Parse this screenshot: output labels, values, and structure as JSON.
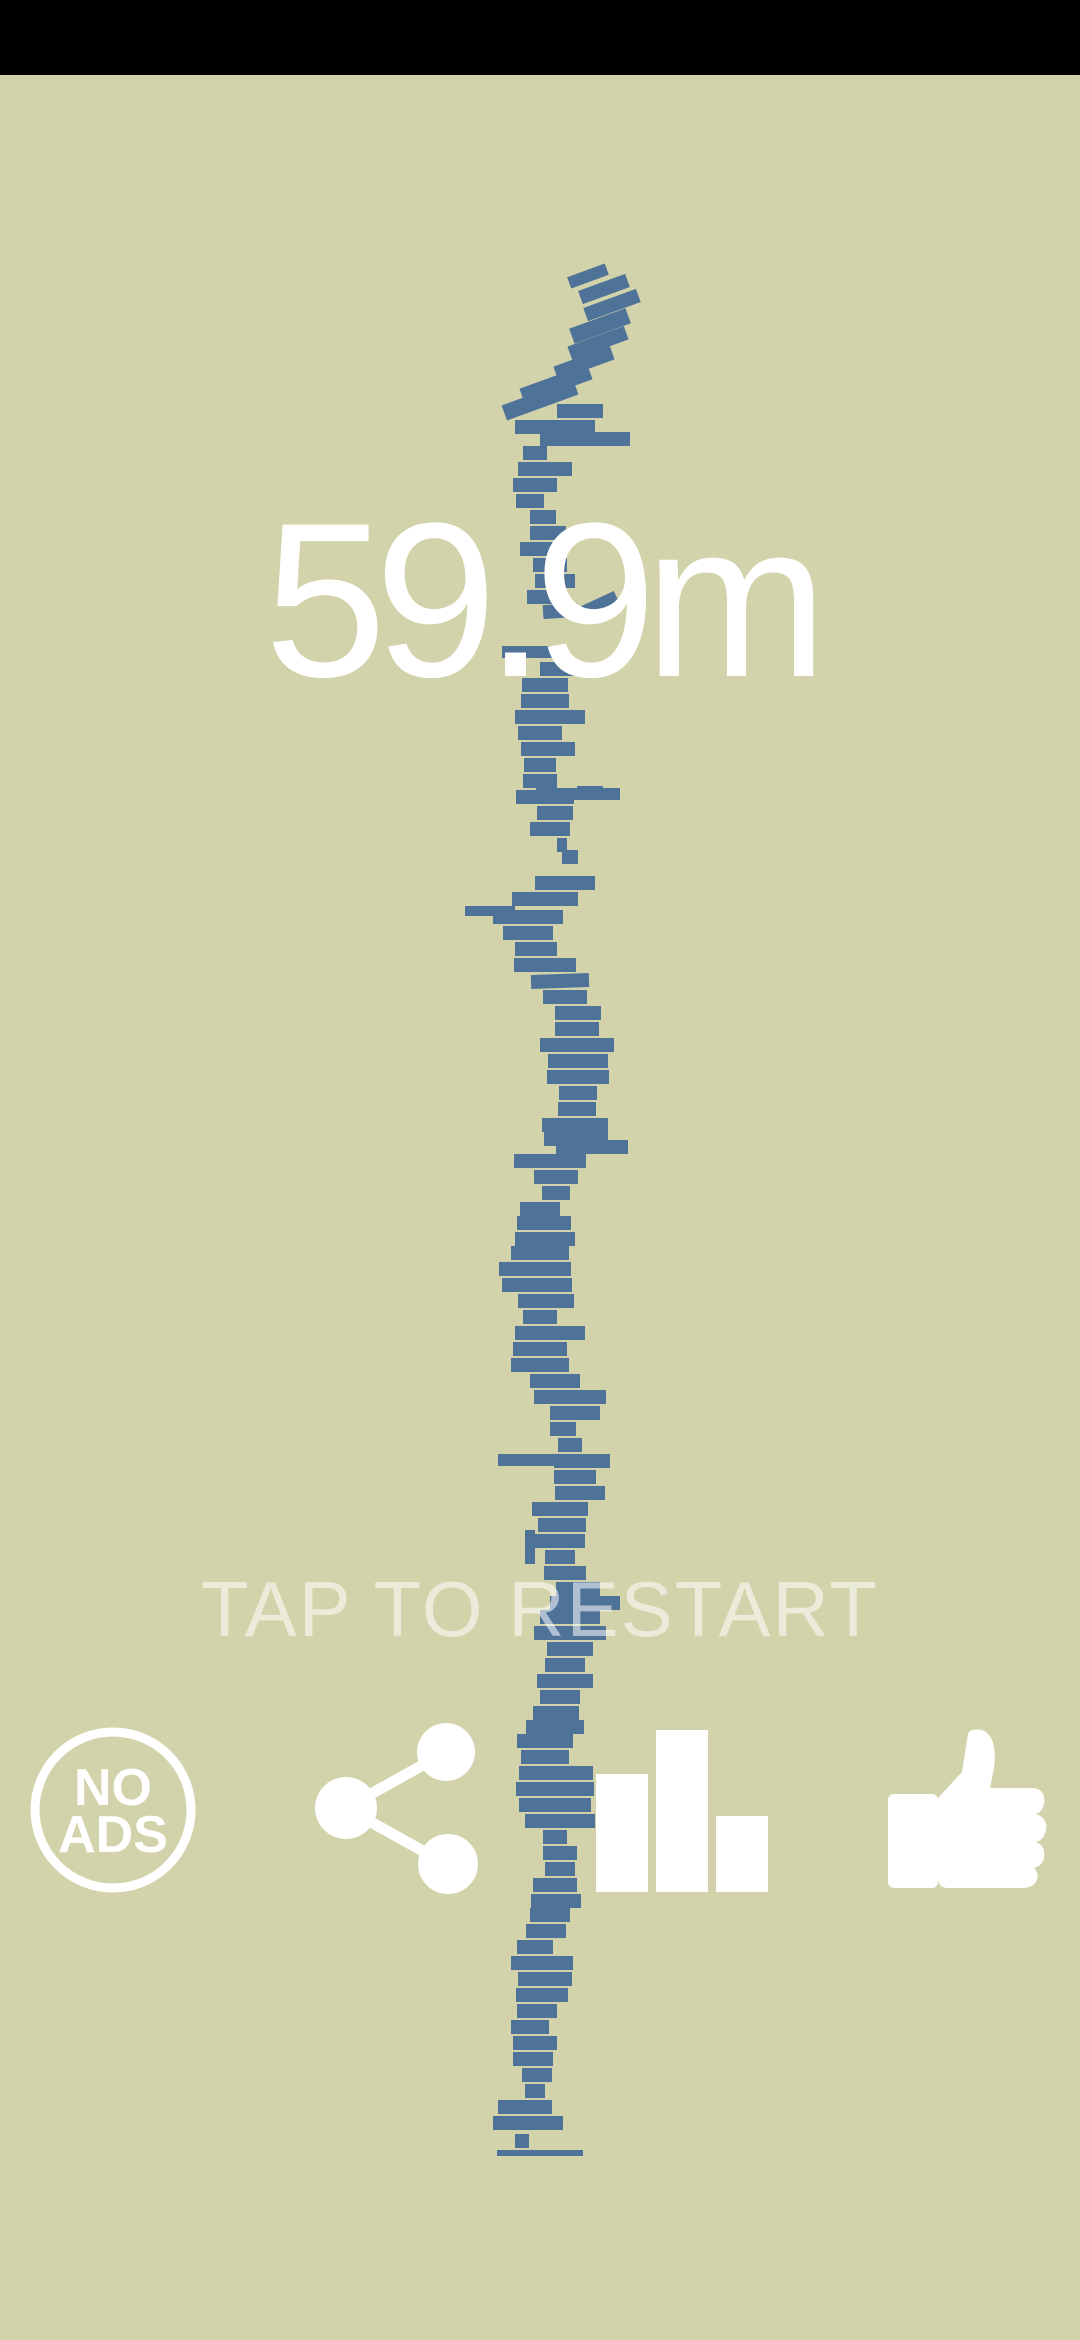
{
  "game": {
    "height_readout": "59.9m",
    "restart_prompt": "TAP TO RESTART"
  },
  "buttons": {
    "no_ads_line1": "NO",
    "no_ads_line2": "ADS",
    "share_icon": "share-icon",
    "leaderboard_icon": "bar-chart-icon",
    "rate_icon": "thumbs-up-icon"
  },
  "colors": {
    "background": "#d2d3aa",
    "block": "#4f7299",
    "status_bar": "#000000",
    "text": "#ffffff"
  }
}
